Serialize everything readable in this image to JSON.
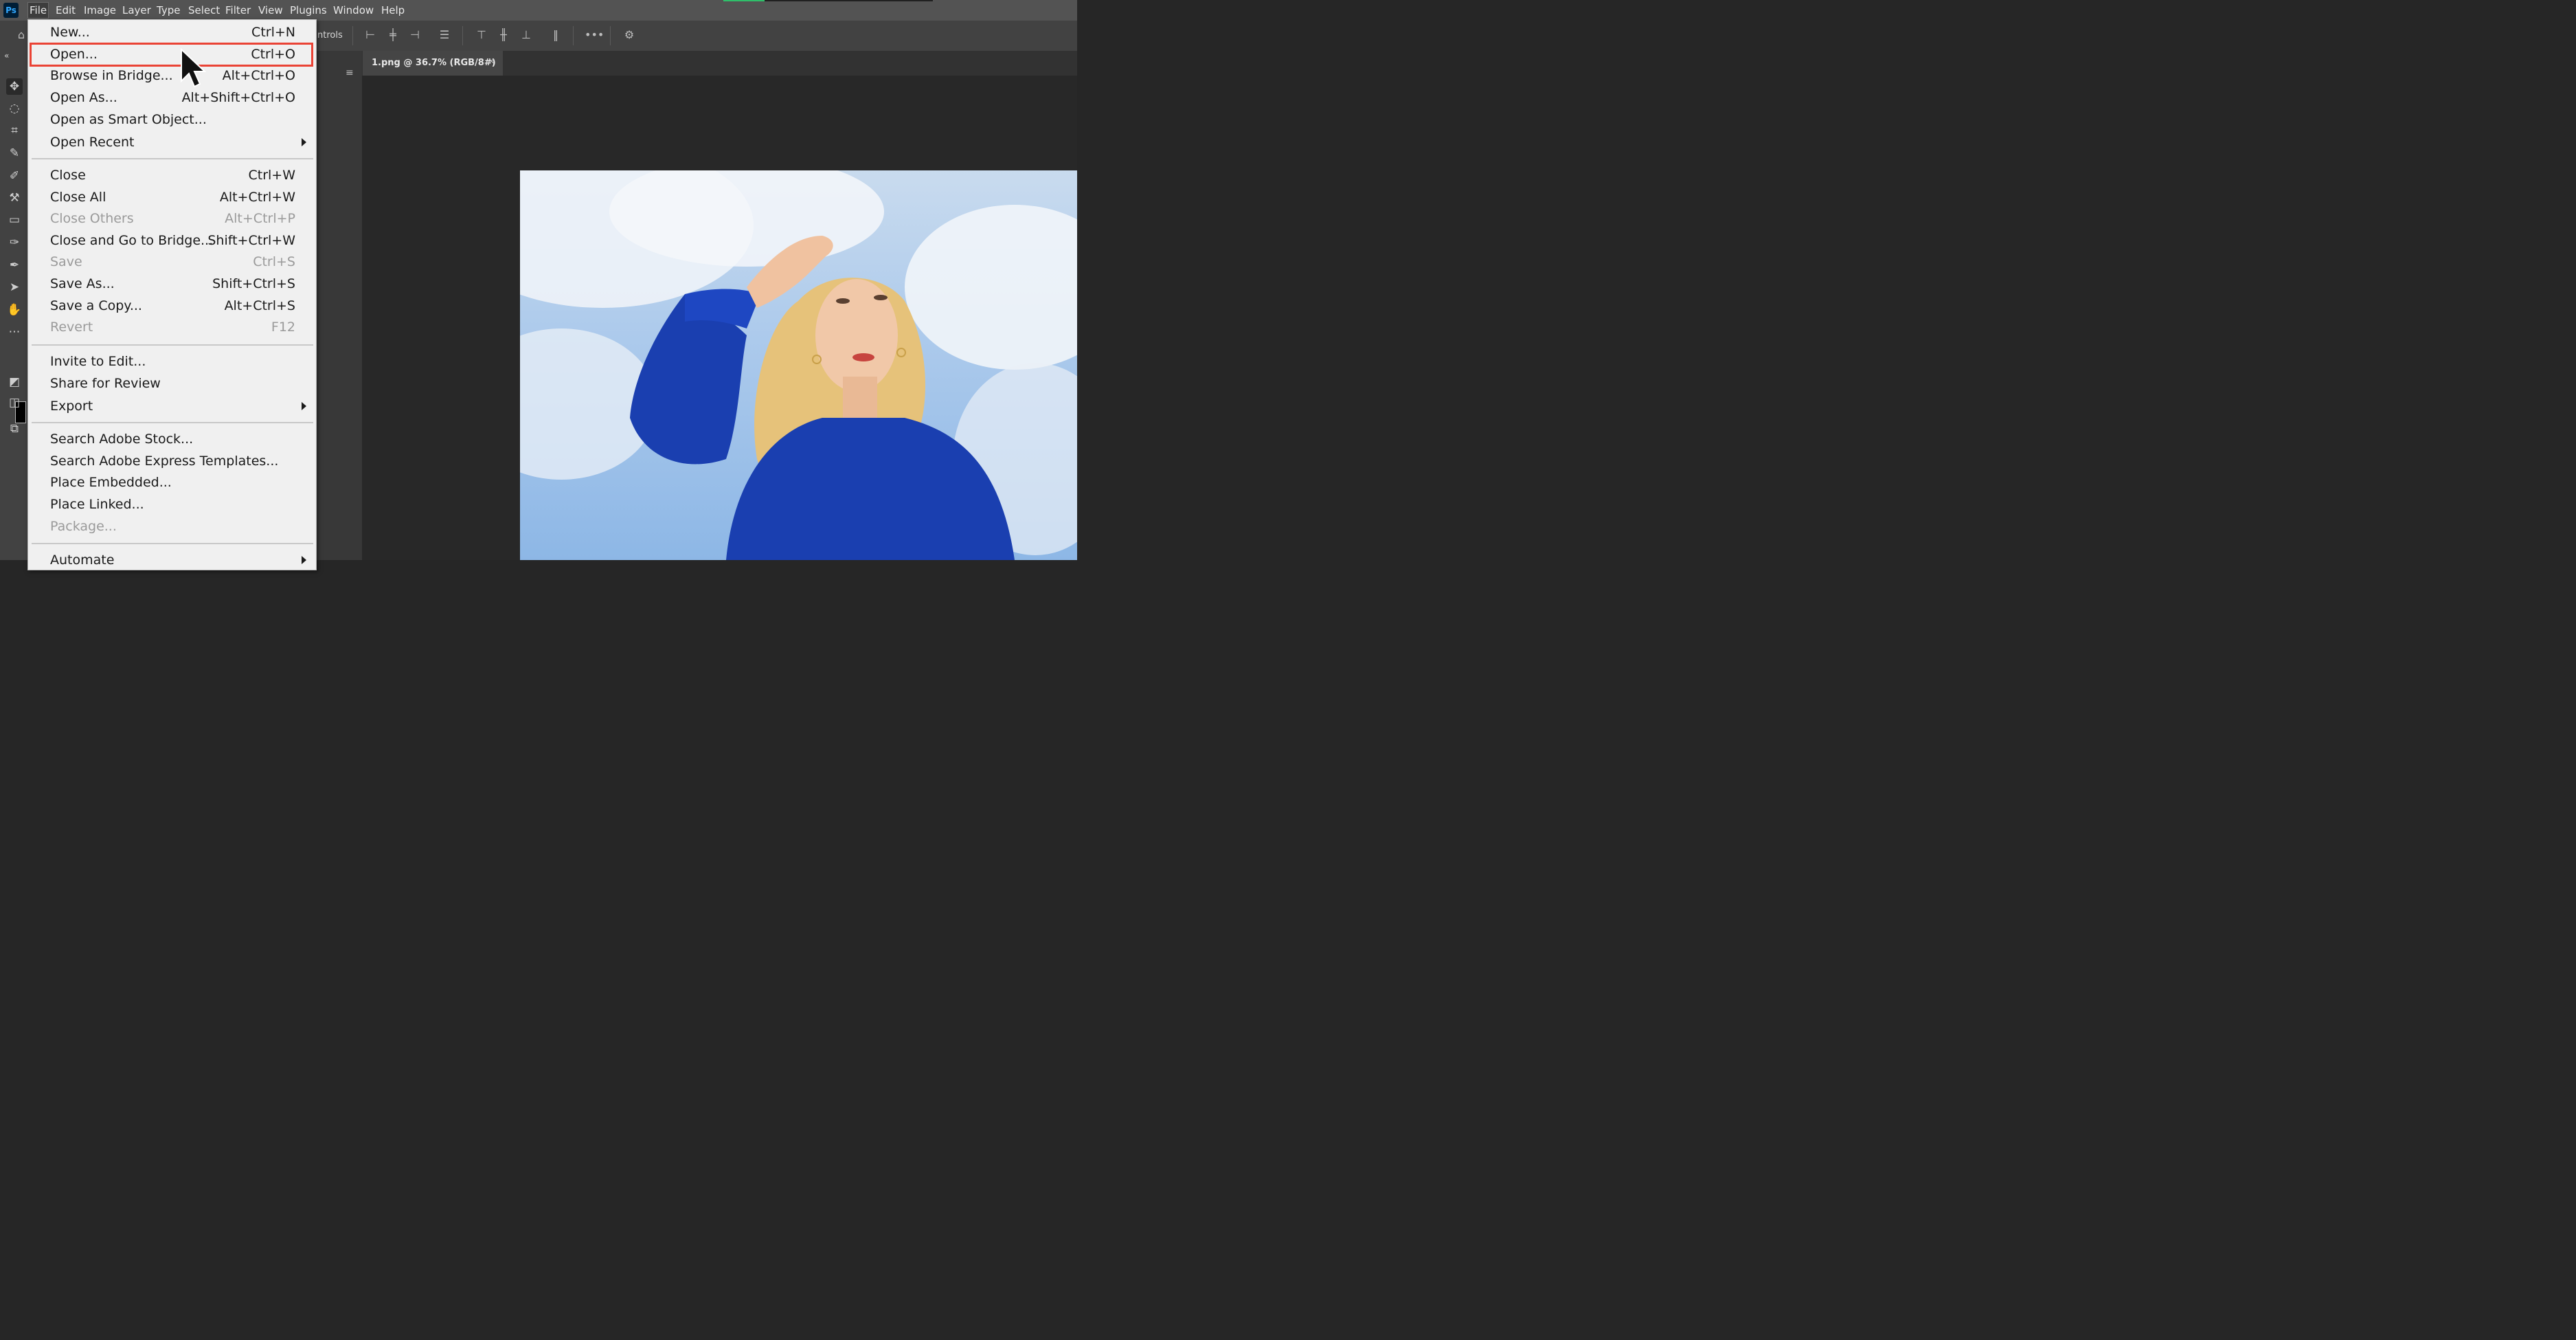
{
  "app": {
    "logo": "Ps"
  },
  "menubar": {
    "items": [
      "File",
      "Edit",
      "Image",
      "Layer",
      "Type",
      "Select",
      "Filter",
      "View",
      "Plugins",
      "Window",
      "Help"
    ]
  },
  "options": {
    "controls_text": "ntrols"
  },
  "document": {
    "tab_title": "1.png @ 36.7% (RGB/8#)",
    "close": "×"
  },
  "file_menu": {
    "items": [
      {
        "label": "New...",
        "shortcut": "Ctrl+N"
      },
      {
        "label": "Open...",
        "shortcut": "Ctrl+O"
      },
      {
        "label": "Browse in Bridge...",
        "shortcut": "Alt+Ctrl+O"
      },
      {
        "label": "Open As...",
        "shortcut": "Alt+Shift+Ctrl+O"
      },
      {
        "label": "Open as Smart Object...",
        "shortcut": ""
      },
      {
        "label": "Open Recent",
        "shortcut": ""
      },
      {
        "label": "Close",
        "shortcut": "Ctrl+W"
      },
      {
        "label": "Close All",
        "shortcut": "Alt+Ctrl+W"
      },
      {
        "label": "Close Others",
        "shortcut": "Alt+Ctrl+P"
      },
      {
        "label": "Close and Go to Bridge...",
        "shortcut": "Shift+Ctrl+W"
      },
      {
        "label": "Save",
        "shortcut": "Ctrl+S"
      },
      {
        "label": "Save As...",
        "shortcut": "Shift+Ctrl+S"
      },
      {
        "label": "Save a Copy...",
        "shortcut": "Alt+Ctrl+S"
      },
      {
        "label": "Revert",
        "shortcut": "F12"
      },
      {
        "label": "Invite to Edit...",
        "shortcut": ""
      },
      {
        "label": "Share for Review",
        "shortcut": ""
      },
      {
        "label": "Export",
        "shortcut": ""
      },
      {
        "label": "Search Adobe Stock...",
        "shortcut": ""
      },
      {
        "label": "Search Adobe Express Templates...",
        "shortcut": ""
      },
      {
        "label": "Place Embedded...",
        "shortcut": ""
      },
      {
        "label": "Place Linked...",
        "shortcut": ""
      },
      {
        "label": "Package...",
        "shortcut": ""
      },
      {
        "label": "Automate",
        "shortcut": ""
      }
    ]
  },
  "colors": {
    "highlight": "#ea4335",
    "menu_bg": "#f0f0f0",
    "shirt": "#1a3fb0"
  }
}
